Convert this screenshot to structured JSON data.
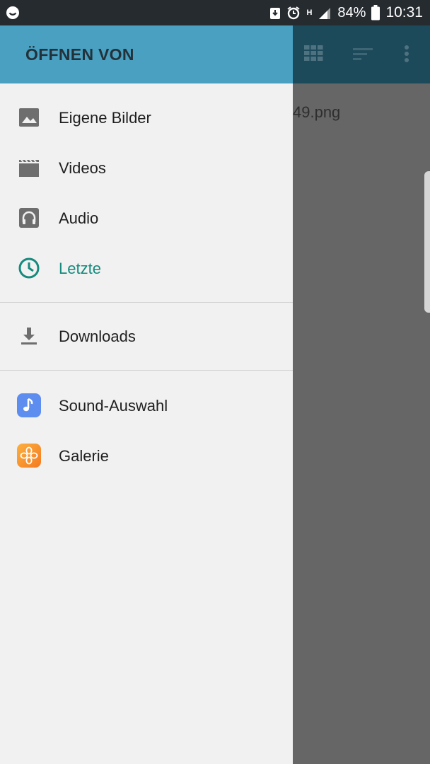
{
  "status_bar": {
    "battery": "84%",
    "time": "10:31",
    "network": "H"
  },
  "background": {
    "visible_file_fragment": "49.png"
  },
  "drawer": {
    "title": "ÖFFNEN VON",
    "group1": [
      {
        "label": "Eigene Bilder",
        "icon": "image-icon"
      },
      {
        "label": "Videos",
        "icon": "video-icon"
      },
      {
        "label": "Audio",
        "icon": "headphones-icon"
      },
      {
        "label": "Letzte",
        "icon": "clock-icon",
        "active": true
      }
    ],
    "group2": [
      {
        "label": "Downloads",
        "icon": "download-icon"
      }
    ],
    "group3": [
      {
        "label": "Sound-Auswahl",
        "icon": "sound-picker-icon"
      },
      {
        "label": "Galerie",
        "icon": "gallery-icon"
      }
    ]
  },
  "colors": {
    "drawer_header": "#49a0c1",
    "active_item": "#158a7d",
    "scrim": "#666666"
  }
}
